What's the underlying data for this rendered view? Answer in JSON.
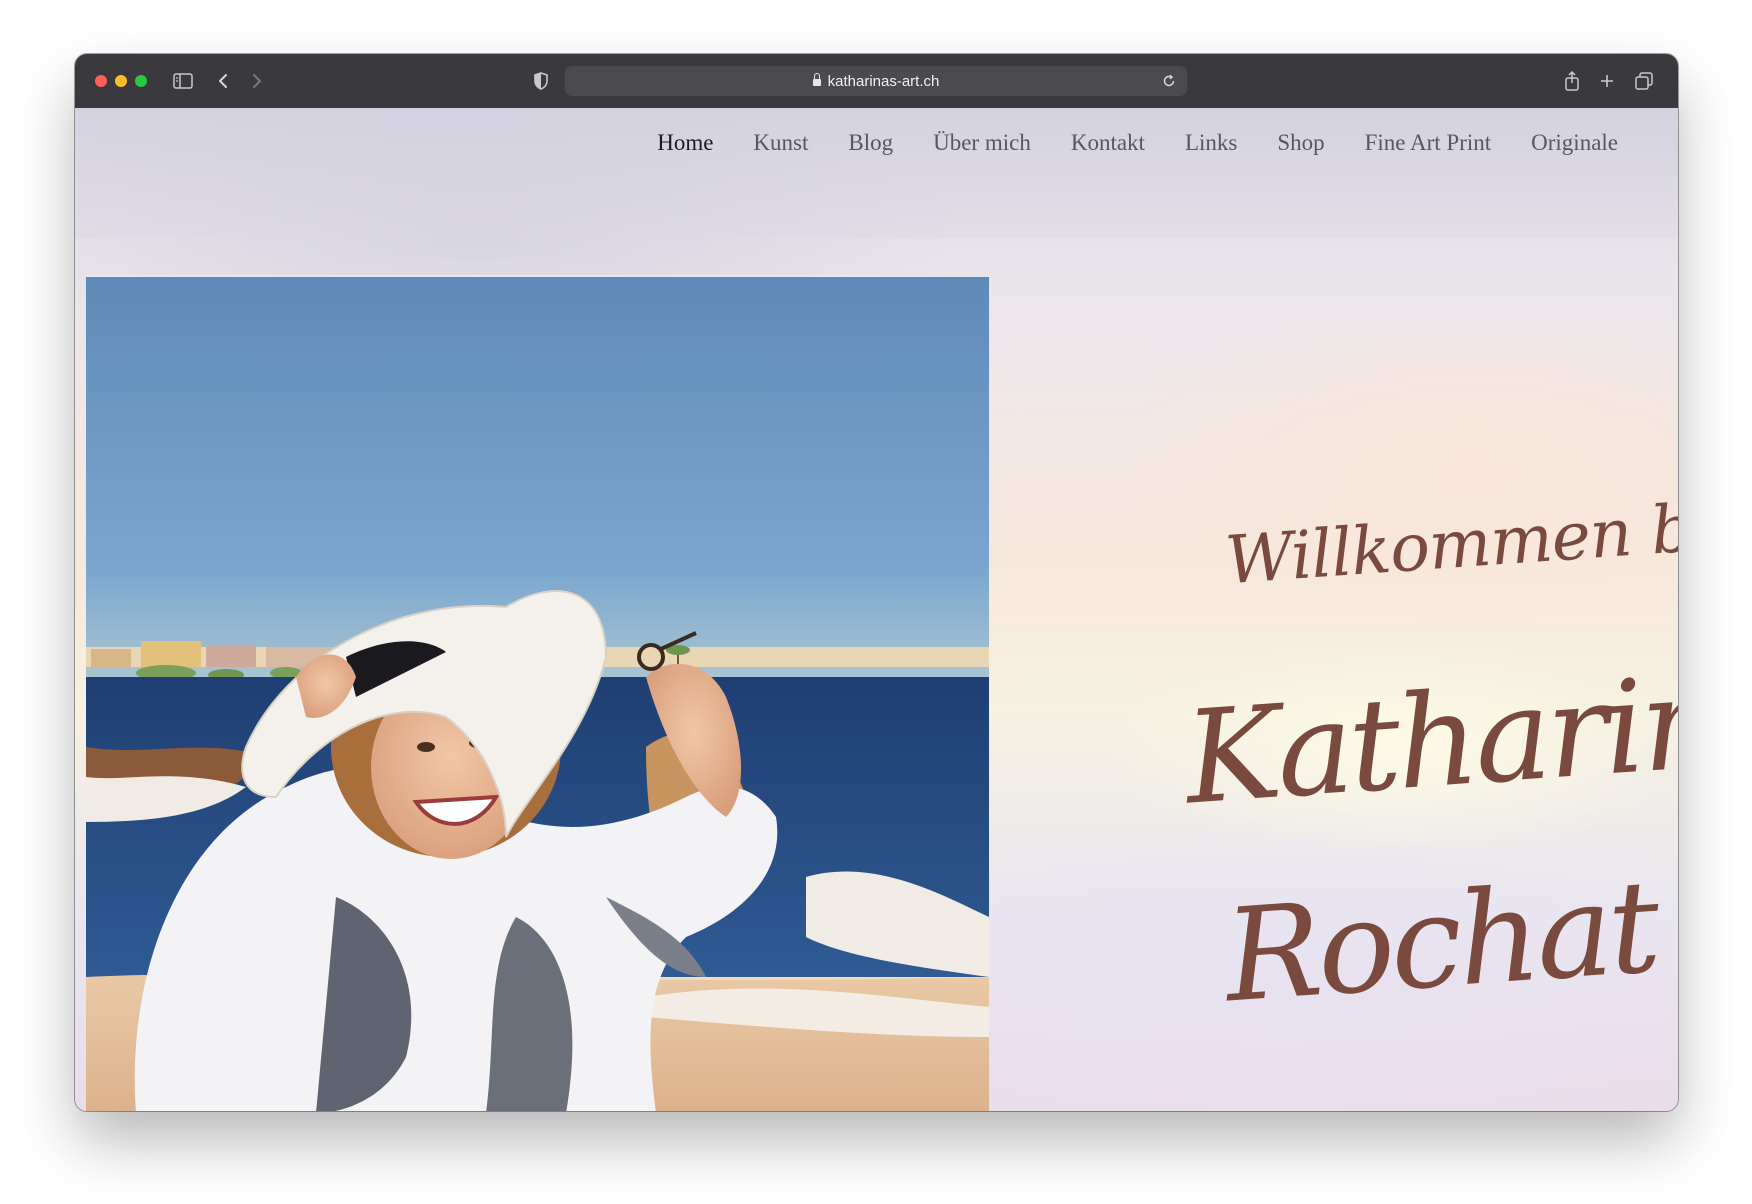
{
  "browser": {
    "url": "katharinas-art.ch"
  },
  "nav": {
    "items": [
      {
        "label": "Home",
        "active": true
      },
      {
        "label": "Kunst",
        "active": false
      },
      {
        "label": "Blog",
        "active": false
      },
      {
        "label": "Über mich",
        "active": false
      },
      {
        "label": "Kontakt",
        "active": false
      },
      {
        "label": "Links",
        "active": false
      },
      {
        "label": "Shop",
        "active": false
      },
      {
        "label": "Fine Art Print",
        "active": false
      },
      {
        "label": "Originale",
        "active": false
      }
    ]
  },
  "hero": {
    "welcome": "Willkommen bei",
    "first_name": "Katharina",
    "last_name": "Rochat"
  },
  "colors": {
    "accent": "#7a4a3e",
    "nav_text": "#5a5560",
    "nav_active": "#1e1b22",
    "toolbar": "#3a393d"
  },
  "icons": {
    "toolbar": [
      "sidebar-icon",
      "back-icon",
      "forward-icon",
      "shield-icon",
      "reload-icon",
      "share-icon",
      "new-tab-icon",
      "tabs-overview-icon"
    ]
  }
}
